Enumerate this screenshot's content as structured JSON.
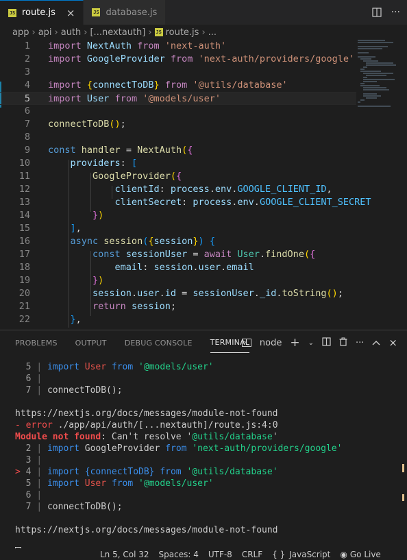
{
  "tabs": [
    {
      "label": "route.js",
      "active": true
    },
    {
      "label": "database.js",
      "active": false
    }
  ],
  "breadcrumb": [
    "app",
    "api",
    "auth",
    "[...nextauth]",
    "route.js",
    "..."
  ],
  "editor": {
    "line_numbers": [
      "1",
      "2",
      "3",
      "4",
      "5",
      "6",
      "7",
      "8",
      "9",
      "10",
      "11",
      "12",
      "13",
      "14",
      "15",
      "16",
      "17",
      "18",
      "19",
      "20",
      "21",
      "22"
    ]
  },
  "panel": {
    "tabs": [
      "PROBLEMS",
      "OUTPUT",
      "DEBUG CONSOLE",
      "TERMINAL"
    ],
    "active_tab": "TERMINAL",
    "terminal_name": "node",
    "lines": {
      "l1_num": "5",
      "l1_a": "import ",
      "l1_b": "User",
      "l1_c": " from ",
      "l1_d": "'@models/user'",
      "l2_num": "6",
      "l3_num": "7",
      "l3_a": "connectToDB();",
      "url1": "https://nextjs.org/docs/messages/module-not-found",
      "err_prefix": "- error",
      "err_path": " ./app/api/auth/[...nextauth]/route.js:4:0",
      "mnf_a": "Module not found",
      "mnf_b": ": Can't resolve '",
      "mnf_c": "@utils/database",
      "mnf_d": "'",
      "l4_num": "2",
      "l4_a": "import ",
      "l4_b": "GoogleProvider",
      "l4_c": " from ",
      "l4_d": "'next-auth/providers/google'",
      "l5_num": "3",
      "l6_marker": ">",
      "l6_num": "4",
      "l6_a": "import {connectToDB} from ",
      "l6_b": "'@utils/database'",
      "l7_num": "5",
      "l7_a": "import ",
      "l7_b": "User",
      "l7_c": " from ",
      "l7_d": "'@models/user'",
      "l8_num": "6",
      "l9_num": "7",
      "l9_a": "connectToDB();",
      "url2": "https://nextjs.org/docs/messages/module-not-found"
    }
  },
  "statusbar": {
    "position": "Ln 5, Col 32",
    "spaces": "Spaces: 4",
    "encoding": "UTF-8",
    "eol": "CRLF",
    "braces": "{ }",
    "language": "JavaScript",
    "golive": "Go Live"
  },
  "colors": {
    "accent": "#007acc",
    "error": "#f14c4c",
    "js_badge": "#cbcb41"
  }
}
